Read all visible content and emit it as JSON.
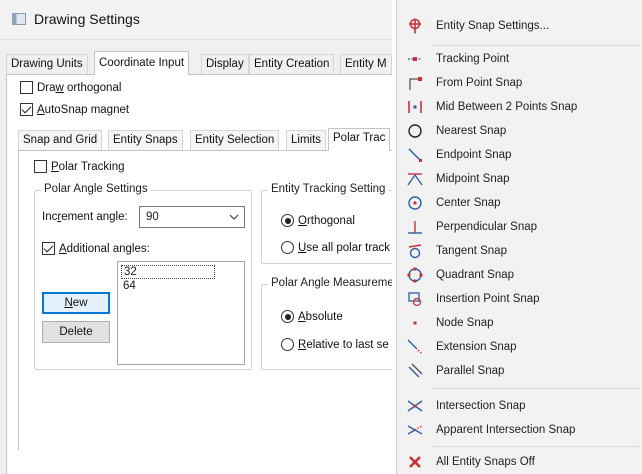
{
  "window": {
    "title": "Drawing Settings"
  },
  "tabs": [
    "Drawing Units",
    "Coordinate Input",
    "Display",
    "Entity Creation",
    "Entity M"
  ],
  "options": {
    "draw_orthogonal": {
      "pre": "Dra",
      "u": "w",
      "post": " orthogonal",
      "checked": false
    },
    "autosnap_magnet": {
      "pre": "",
      "u": "A",
      "post": "utoSnap magnet",
      "checked": true
    }
  },
  "subtabs": [
    "Snap and Grid",
    "Entity Snaps",
    "Entity Selection",
    "Limits",
    "Polar Trac"
  ],
  "polar": {
    "tracking": {
      "pre": "",
      "u": "P",
      "post": "olar Tracking",
      "checked": false
    },
    "angle_group_title": "Polar Angle Settings",
    "increment_label": {
      "pre": "Inc",
      "u": "r",
      "post": "ement angle:"
    },
    "increment_value": "90",
    "additional": {
      "pre": "",
      "u": "A",
      "post": "dditional angles:",
      "checked": true
    },
    "angles": [
      "32",
      "64"
    ],
    "new_button": {
      "pre": "",
      "u": "N",
      "post": "ew"
    },
    "delete_button": "Delete"
  },
  "tracking_group": {
    "title": "Entity Tracking Setting",
    "orthogonal": {
      "pre": "",
      "u": "O",
      "post": "rthogonal",
      "selected": true
    },
    "all_polar": {
      "pre": "",
      "u": "U",
      "post": "se all polar track",
      "selected": false
    }
  },
  "measure_group": {
    "title": "Polar Angle Measureme",
    "absolute": {
      "pre": "",
      "u": "A",
      "post": "bsolute",
      "selected": true
    },
    "relative": {
      "pre": "",
      "u": "R",
      "post": "elative to last se",
      "selected": false
    }
  },
  "menu": {
    "items": [
      {
        "label": "Entity Snap Settings...",
        "icon": "snap-settings-icon"
      },
      {
        "label": "Tracking Point",
        "icon": "tracking-point-icon"
      },
      {
        "label": "From Point Snap",
        "icon": "from-point-icon"
      },
      {
        "label": "Mid Between 2 Points Snap",
        "icon": "mid-between-icon"
      },
      {
        "label": "Nearest Snap",
        "icon": "nearest-icon"
      },
      {
        "label": "Endpoint Snap",
        "icon": "endpoint-icon"
      },
      {
        "label": "Midpoint Snap",
        "icon": "midpoint-icon"
      },
      {
        "label": "Center Snap",
        "icon": "center-icon"
      },
      {
        "label": "Perpendicular Snap",
        "icon": "perpendicular-icon"
      },
      {
        "label": "Tangent Snap",
        "icon": "tangent-icon"
      },
      {
        "label": "Quadrant Snap",
        "icon": "quadrant-icon"
      },
      {
        "label": "Insertion Point Snap",
        "icon": "insertion-icon"
      },
      {
        "label": "Node Snap",
        "icon": "node-icon"
      },
      {
        "label": "Extension Snap",
        "icon": "extension-icon"
      },
      {
        "label": "Parallel Snap",
        "icon": "parallel-icon"
      },
      {
        "label": "Intersection Snap",
        "icon": "intersection-icon"
      },
      {
        "label": "Apparent Intersection Snap",
        "icon": "apparent-intersection-icon"
      },
      {
        "label": "All Entity Snaps Off",
        "icon": "snaps-off-icon"
      }
    ]
  },
  "colors": {
    "icon_red": "#c8323c",
    "icon_blue": "#2d5fa8",
    "accent": "#0078d7"
  }
}
